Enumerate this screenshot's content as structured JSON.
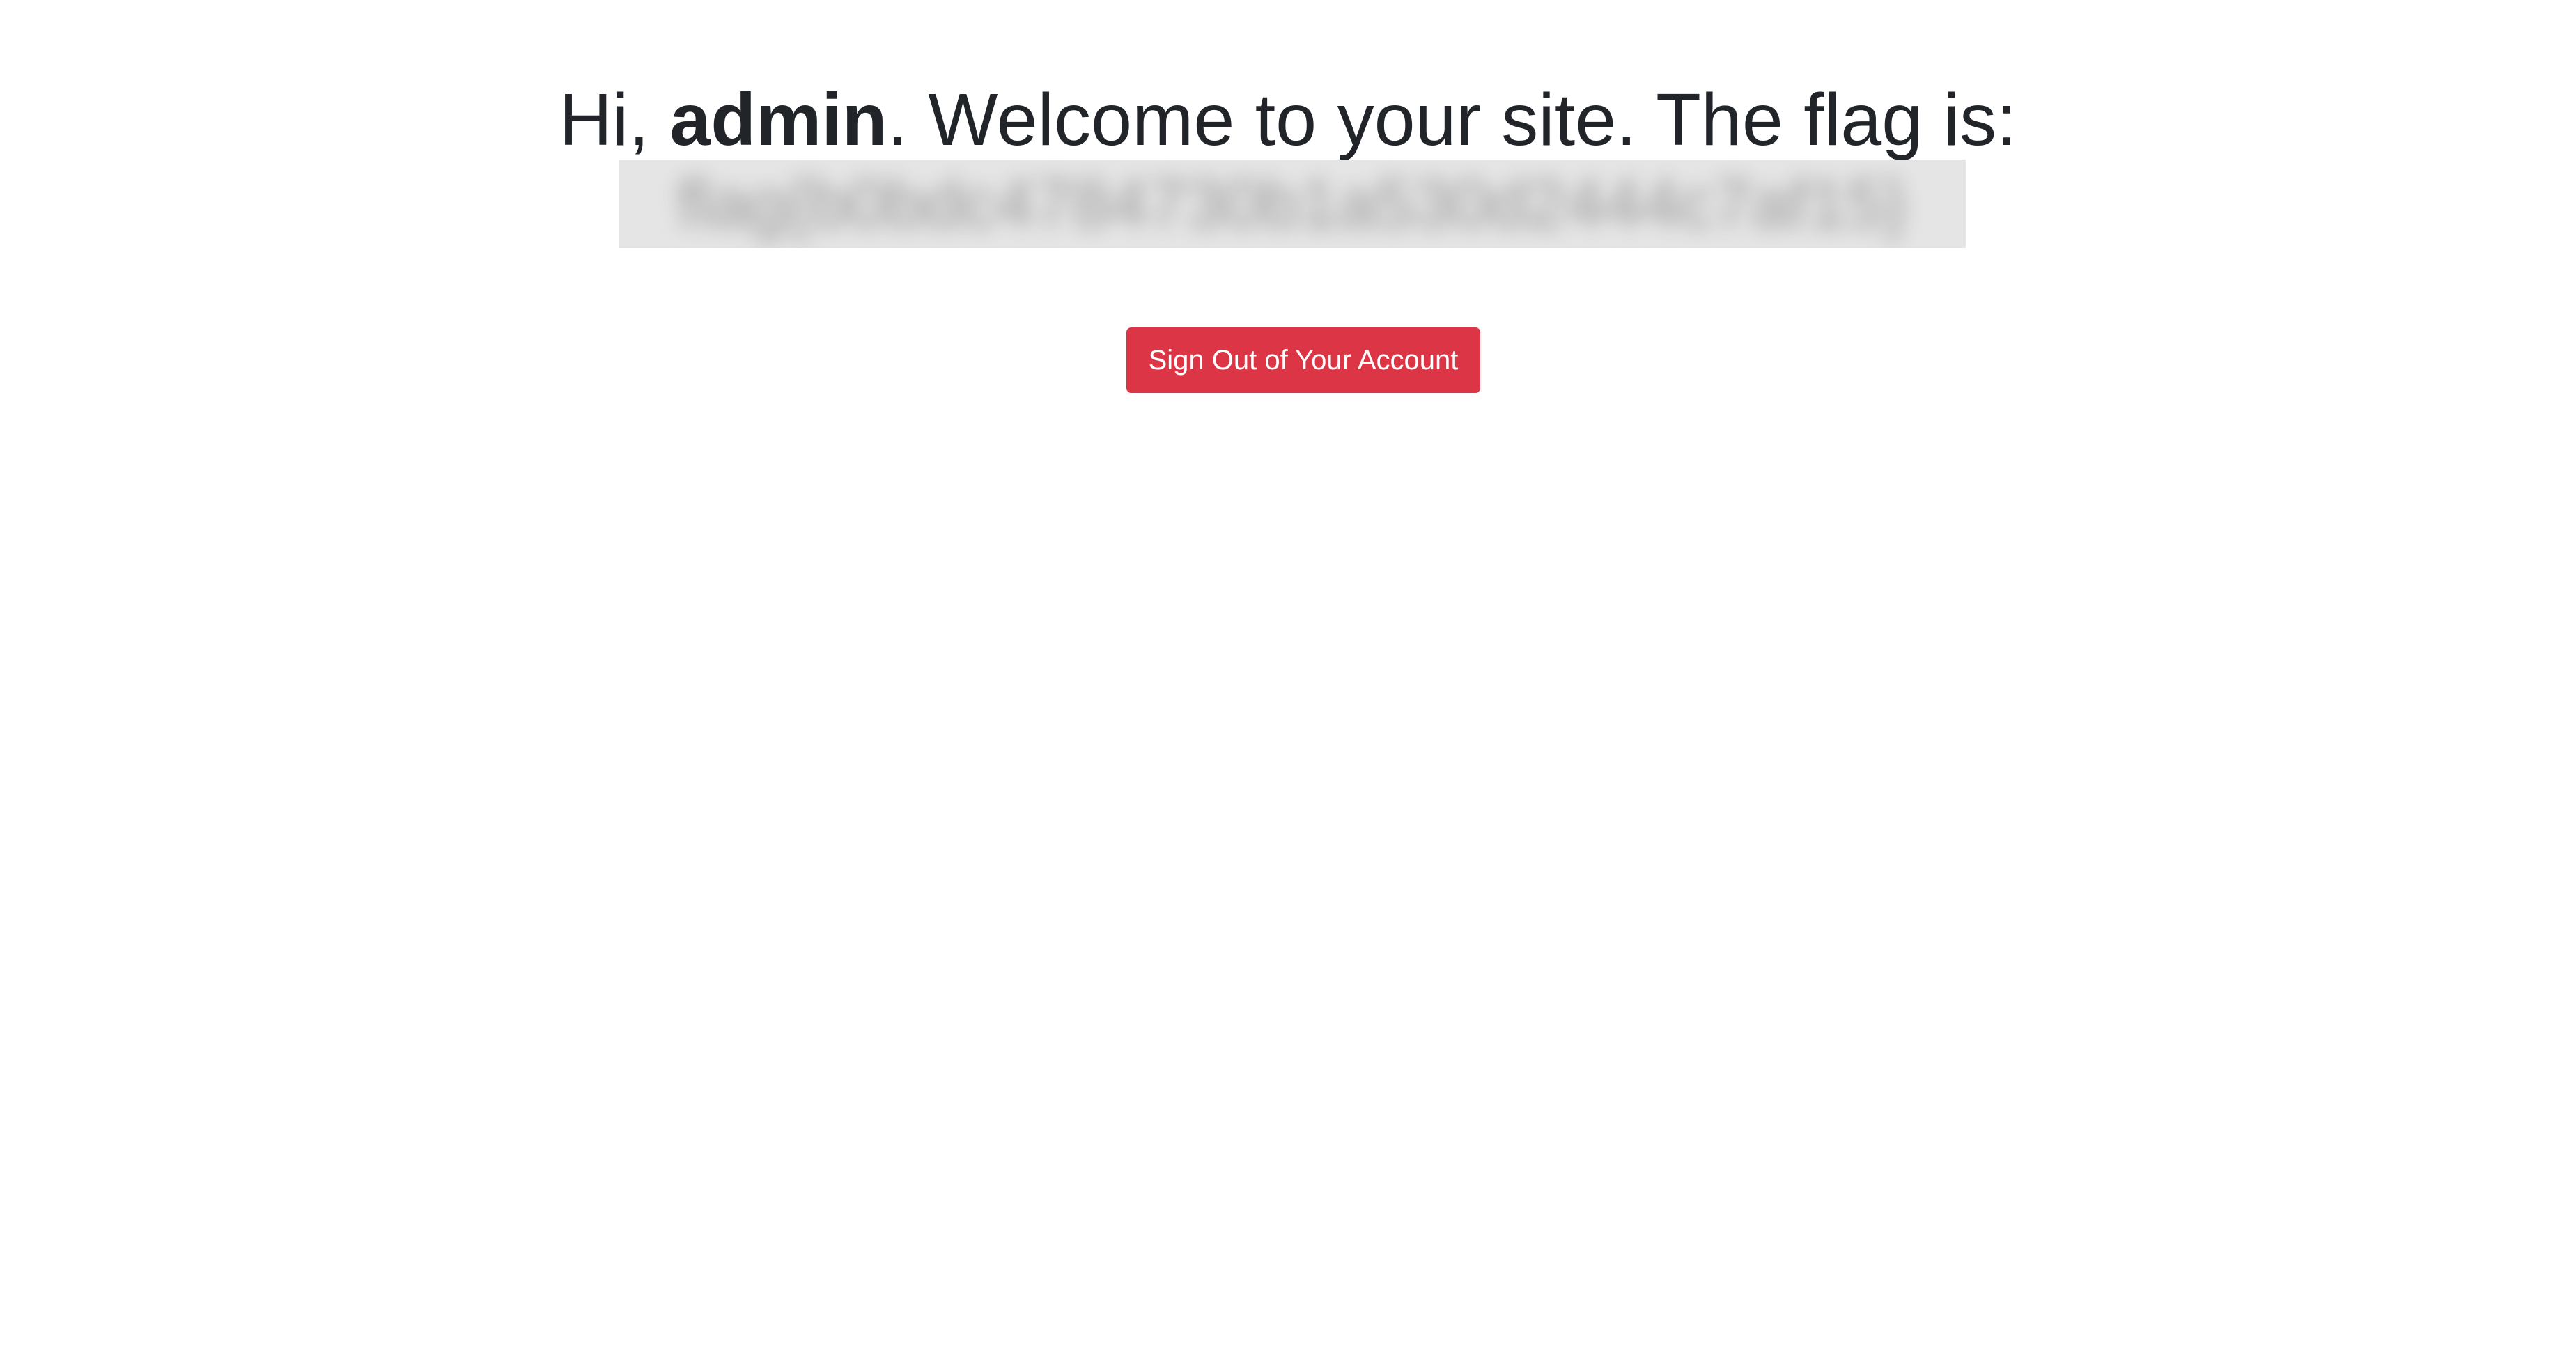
{
  "welcome": {
    "prefix": "Hi, ",
    "username": "admin",
    "suffix": ". Welcome to your site. The flag is:"
  },
  "flag": {
    "value": "flag{b0bdc4784730b1a530d2444c7af15}"
  },
  "actions": {
    "sign_out_label": "Sign Out of Your Account"
  },
  "colors": {
    "text": "#212529",
    "danger": "#dc3545",
    "flag_background": "#e5e5e5"
  }
}
